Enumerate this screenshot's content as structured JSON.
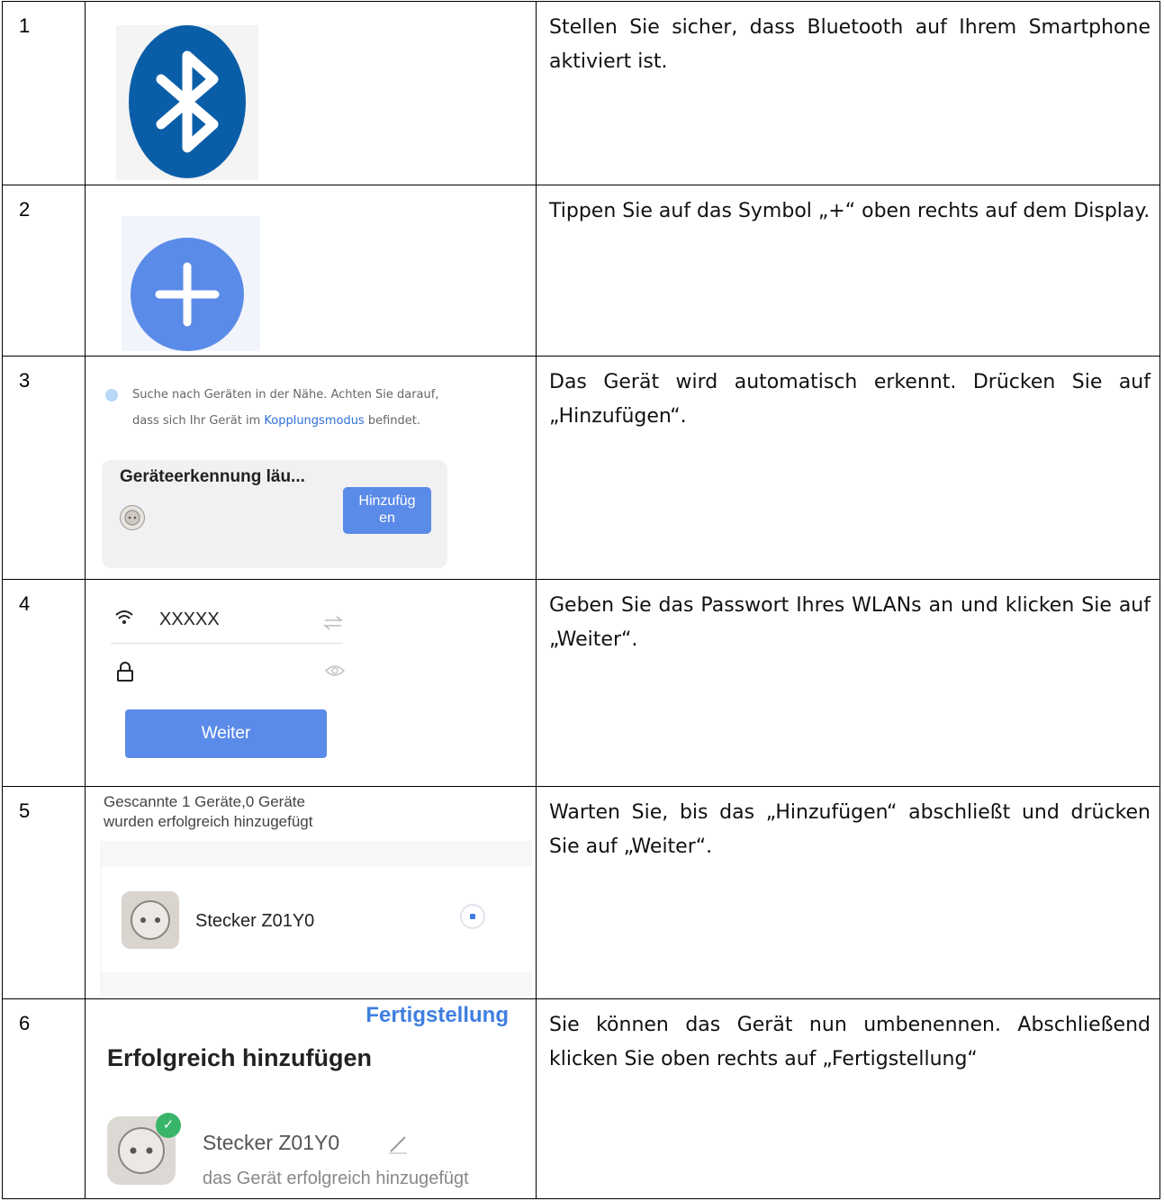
{
  "steps": [
    {
      "number": "1",
      "text": "Stellen Sie sicher, dass Bluetooth auf Ihrem Smartphone aktiviert ist."
    },
    {
      "number": "2",
      "text": "Tippen Sie auf das Symbol „+“ oben rechts auf dem Display."
    },
    {
      "number": "3",
      "text": "Das Gerät wird automatisch erkennt. Drücken Sie auf „Hinzufügen“."
    },
    {
      "number": "4",
      "text": "Geben Sie das Passwort Ihres WLANs an und klicken Sie auf „Weiter“."
    },
    {
      "number": "5",
      "text": "Warten Sie, bis das „Hinzufügen“ abschließt und drücken Sie auf „Weiter“."
    },
    {
      "number": "6",
      "text": "Sie können das Gerät nun umbenennen. Abschließend klicken Sie oben rechts auf „Fertigstellung“"
    }
  ],
  "step3": {
    "scan_line1": "Suche nach Geräten in der Nähe. Achten Sie darauf,",
    "scan_line2_prefix": "dass sich Ihr Gerät im ",
    "scan_link": "Kopplungsmodus",
    "scan_line2_suffix": " befindet.",
    "card_title": "Geräteerkennung läu...",
    "button_line1": "Hinzufüg",
    "button_line2": "en"
  },
  "step4": {
    "ssid": "XXXXX",
    "button": "Weiter"
  },
  "step5": {
    "status_line1": "Gescannte 1 Geräte,0 Geräte",
    "status_line2": "wurden erfolgreich hinzugefügt",
    "device_name": "Stecker Z01Y0"
  },
  "step6": {
    "done_button": "Fertigstellung",
    "heading": "Erfolgreich hinzufügen",
    "device_name": "Stecker Z01Y0",
    "device_status": "das Gerät erfolgreich hinzugefügt"
  },
  "icons": {
    "step1": "bluetooth-icon",
    "step2": "plus-icon",
    "step4_wifi": "wifi-icon",
    "step4_swap": "swap-icon",
    "step4_lock": "lock-icon",
    "step4_eye": "eye-icon",
    "step6_edit": "pencil-icon",
    "step6_check": "check-icon"
  },
  "colors": {
    "bluetooth_blue": "#0a5ea8",
    "accent_blue": "#5b8be8",
    "link_blue": "#2f70d6",
    "success_green": "#39b56a"
  }
}
